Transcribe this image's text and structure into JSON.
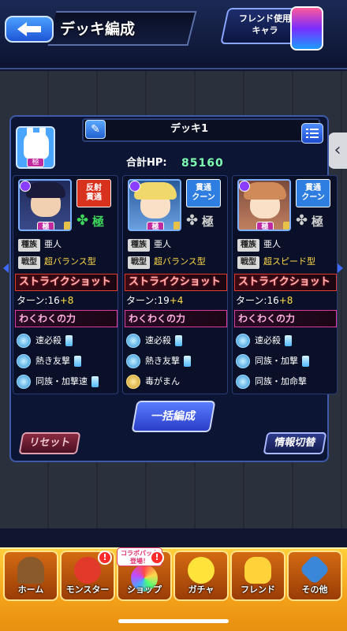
{
  "header": {
    "title": "デッキ編成",
    "friend_button": "フレンド使用\nキャラ"
  },
  "deck": {
    "name": "デッキ1",
    "hp_label": "合計HP:",
    "hp_value": "85160"
  },
  "cards": [
    {
      "gimmick": "反射\n貫通",
      "gimmick_color": "#d8321e",
      "kyoku_label": "極",
      "clover_color": "#3cd45a",
      "race_tag": "種族",
      "race": "亜人",
      "type_tag": "戦型",
      "type": "超バランス型",
      "strike_label": "ストライクショット",
      "turn_prefix": "ターン:16",
      "turn_plus": "+8",
      "waku_label": "わくわくの力",
      "abilities": [
        "速必殺",
        "熱き友撃",
        "同族・加撃速"
      ]
    },
    {
      "gimmick": "貫通\nクーン",
      "gimmick_color": "#2e7de0",
      "kyoku_label": "極",
      "clover_color": "#cfcfcf",
      "race_tag": "種族",
      "race": "亜人",
      "type_tag": "戦型",
      "type": "超バランス型",
      "strike_label": "ストライクショット",
      "turn_prefix": "ターン:19",
      "turn_plus": "+4",
      "waku_label": "わくわくの力",
      "abilities": [
        "速必殺",
        "熱き友撃",
        "毒がまん"
      ]
    },
    {
      "gimmick": "貫通\nクーン",
      "gimmick_color": "#2e7de0",
      "kyoku_label": "極",
      "clover_color": "#cfcfcf",
      "race_tag": "種族",
      "race": "亜人",
      "type_tag": "戦型",
      "type": "超スピード型",
      "strike_label": "ストライクショット",
      "turn_prefix": "ターン:16",
      "turn_plus": "+8",
      "waku_label": "わくわくの力",
      "abilities": [
        "速必殺",
        "同族・加撃",
        "同族・加命撃"
      ]
    }
  ],
  "buttons": {
    "bulk": "一括編成",
    "reset": "リセット",
    "info": "情報切替"
  },
  "nav": {
    "collab_badge": "コラボパック\n登場！",
    "alert_mark": "!",
    "items": [
      {
        "label": "ホーム",
        "icon": "home-icon",
        "color": "#8a5a2a"
      },
      {
        "label": "モンスター",
        "icon": "monster-icon",
        "color": "#e23a2a"
      },
      {
        "label": "ショップ",
        "icon": "shop-icon",
        "color": "#bfe8ff"
      },
      {
        "label": "ガチャ",
        "icon": "gacha-icon",
        "color": "#ffe23a"
      },
      {
        "label": "フレンド",
        "icon": "friend-icon",
        "color": "#ffd23a"
      },
      {
        "label": "その他",
        "icon": "other-icon",
        "color": "#3a86d8"
      }
    ]
  }
}
